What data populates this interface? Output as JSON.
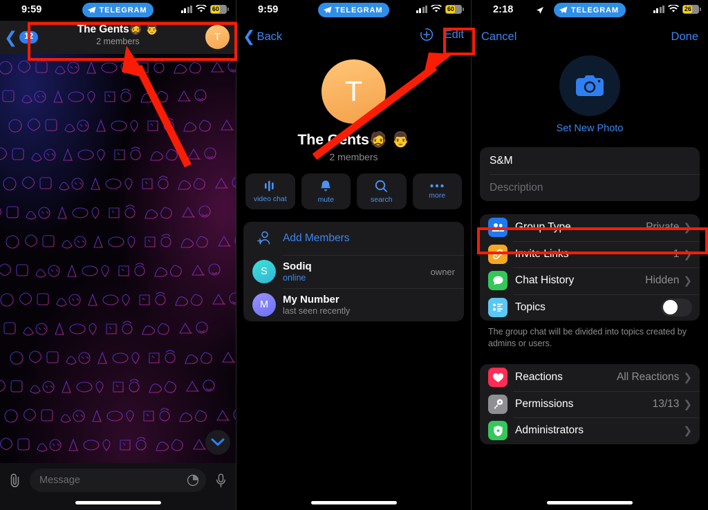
{
  "left": {
    "status": {
      "time": "9:59",
      "carrier_pill": "TELEGRAM",
      "battery": "60"
    },
    "nav": {
      "unread_count": "12",
      "title": "The Gents🧔 👨",
      "subtitle": "2 members",
      "avatar_letter": "T"
    },
    "composer": {
      "placeholder": "Message"
    }
  },
  "mid": {
    "status": {
      "time": "9:59",
      "carrier_pill": "TELEGRAM",
      "battery": "60"
    },
    "nav": {
      "back_label": "Back",
      "edit_label": "Edit"
    },
    "profile": {
      "avatar_letter": "T",
      "title": "The Gents🧔 👨",
      "subtitle": "2 members"
    },
    "actions": [
      {
        "label": "video chat",
        "icon": "video-chat-icon"
      },
      {
        "label": "mute",
        "icon": "bell-icon"
      },
      {
        "label": "search",
        "icon": "search-icon"
      },
      {
        "label": "more",
        "icon": "more-dots-icon"
      }
    ],
    "add_members_label": "Add Members",
    "members": [
      {
        "name": "Sodiq",
        "status": "online",
        "status_kind": "online",
        "badge": "owner",
        "initial": "S",
        "color1": "#3ee0d8",
        "color2": "#2fb6d6"
      },
      {
        "name": "My Number",
        "status": "last seen recently",
        "status_kind": "muted",
        "badge": "",
        "initial": "M",
        "color1": "#8e8bff",
        "color2": "#6b6ff3"
      }
    ]
  },
  "right": {
    "status": {
      "time": "2:18",
      "carrier_pill": "TELEGRAM",
      "battery": "26"
    },
    "nav": {
      "cancel_label": "Cancel",
      "done_label": "Done"
    },
    "photo": {
      "set_new_photo_label": "Set New Photo"
    },
    "fields": {
      "name_value": "S&M",
      "description_placeholder": "Description"
    },
    "settings_group_1": [
      {
        "label": "Group Type",
        "value": "Private",
        "icon": "group-people-icon",
        "color": "#1f7af0",
        "chevron": true,
        "toggle": null
      },
      {
        "label": "Invite Links",
        "value": "1",
        "icon": "link-icon",
        "color": "#f5a623",
        "chevron": true,
        "toggle": null
      },
      {
        "label": "Chat History",
        "value": "Hidden",
        "icon": "chat-bubble-icon",
        "color": "#34c759",
        "chevron": true,
        "toggle": null
      },
      {
        "label": "Topics",
        "value": "",
        "icon": "list-bullets-icon",
        "color": "#5ac8f5",
        "chevron": false,
        "toggle": "off"
      }
    ],
    "note": "The group chat will be divided into topics created by admins or users.",
    "settings_group_2": [
      {
        "label": "Reactions",
        "value": "All Reactions",
        "icon": "heart-icon",
        "color": "#ff2d55",
        "chevron": true
      },
      {
        "label": "Permissions",
        "value": "13/13",
        "icon": "key-icon",
        "color": "#8e8e93",
        "chevron": true
      },
      {
        "label": "Administrators",
        "value": "",
        "icon": "shield-star-icon",
        "color": "#34c759",
        "chevron": true
      }
    ]
  },
  "annotations": {
    "highlight_color": "#fa1d05",
    "boxes": [
      "chat-header-highlight",
      "edit-button-highlight",
      "invite-links-highlight"
    ],
    "arrows": [
      "arrow-to-chat-header",
      "arrow-to-edit-button"
    ]
  }
}
